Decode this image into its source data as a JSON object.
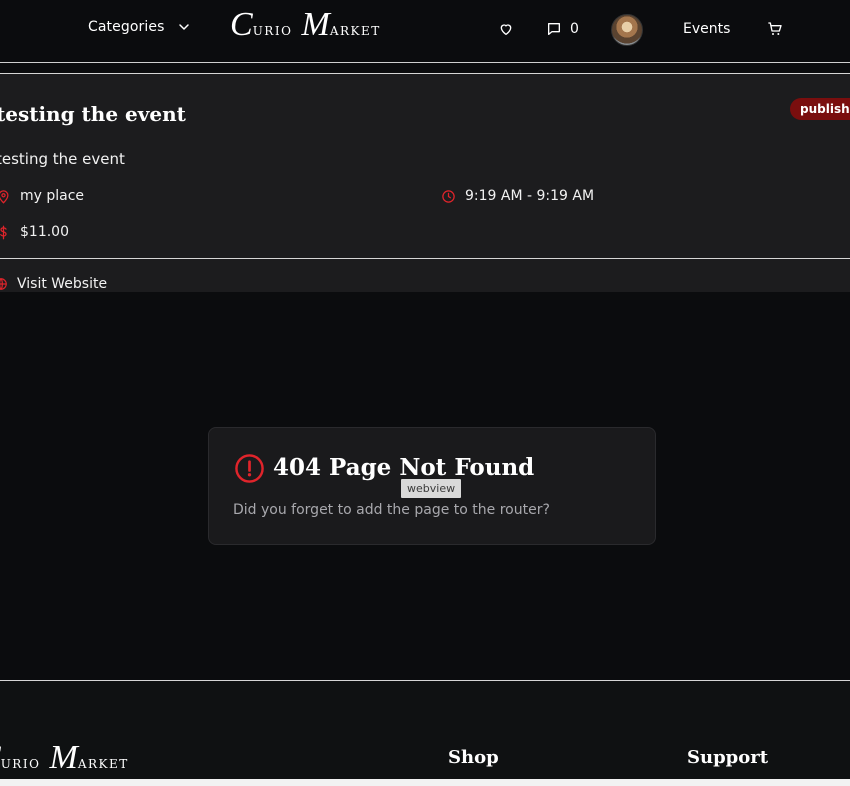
{
  "header": {
    "categories_label": "Categories",
    "logo": {
      "first_big": "C",
      "first_rest": "urio",
      "second_big": "M",
      "second_rest": "arket"
    },
    "messages_count": "0",
    "events_label": "Events"
  },
  "event": {
    "title": "testing the event",
    "status": "published",
    "description": "testing the event",
    "location": "my place",
    "time": "9:19 AM - 9:19 AM",
    "price": "$11.00",
    "website_label": "Visit Website"
  },
  "not_found": {
    "title": "404 Page Not Found",
    "message": "Did you forget to add the page to the router?",
    "tooltip": "webview"
  },
  "footer": {
    "shop_heading": "Shop",
    "support_heading": "Support"
  },
  "colors": {
    "accent_red": "#e0242b",
    "badge_bg": "#7a0e0e",
    "page_bg": "#0b0c0e",
    "card_bg": "#1c1c1e"
  },
  "icons": [
    "chevron-down-icon",
    "heart-icon",
    "message-icon",
    "cart-icon",
    "map-pin-icon",
    "clock-icon",
    "dollar-icon",
    "globe-icon",
    "alert-circle-icon"
  ]
}
